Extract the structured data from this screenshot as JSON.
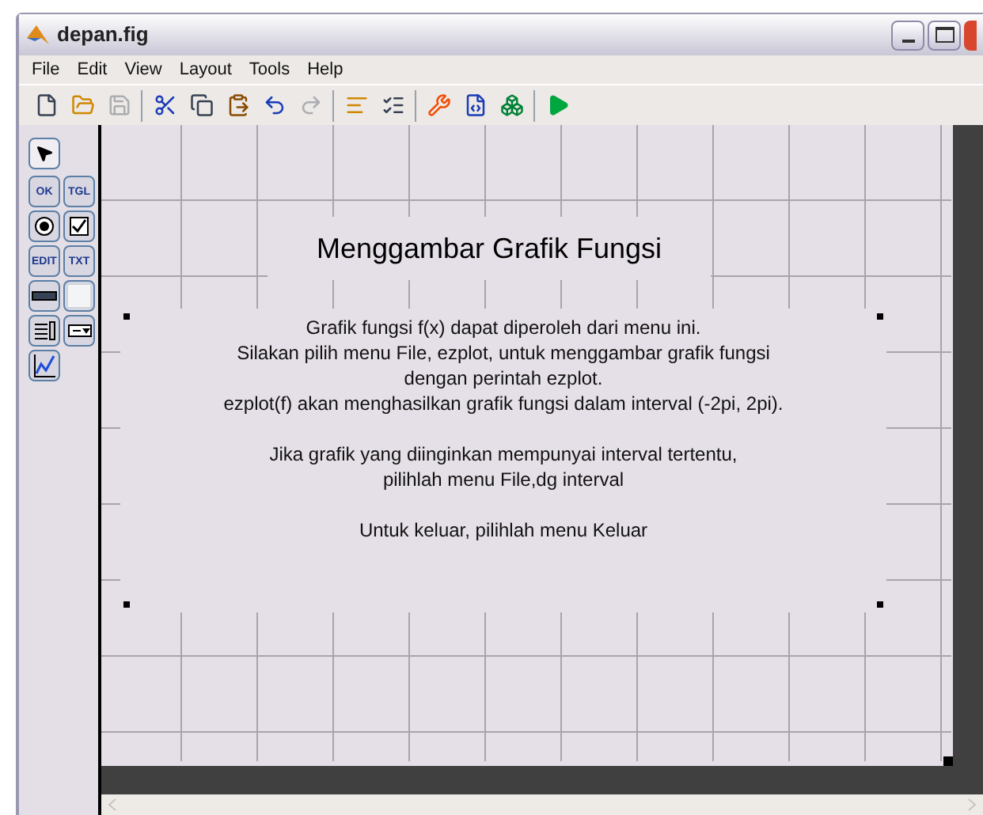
{
  "window": {
    "title": "depan.fig"
  },
  "menu": [
    {
      "label": "File"
    },
    {
      "label": "Edit"
    },
    {
      "label": "View"
    },
    {
      "label": "Layout"
    },
    {
      "label": "Tools"
    },
    {
      "label": "Help"
    }
  ],
  "toolbar": [
    {
      "kind": "new",
      "disabled": false
    },
    {
      "kind": "open",
      "disabled": false
    },
    {
      "kind": "save",
      "disabled": true
    },
    {
      "kind": "sep"
    },
    {
      "kind": "cut",
      "disabled": false
    },
    {
      "kind": "copy",
      "disabled": false
    },
    {
      "kind": "paste",
      "disabled": false
    },
    {
      "kind": "undo",
      "disabled": false
    },
    {
      "kind": "redo",
      "disabled": true
    },
    {
      "kind": "sep"
    },
    {
      "kind": "align",
      "disabled": false
    },
    {
      "kind": "menu-editor",
      "disabled": false
    },
    {
      "kind": "sep"
    },
    {
      "kind": "property",
      "disabled": false
    },
    {
      "kind": "mfile",
      "disabled": false
    },
    {
      "kind": "browser",
      "disabled": false
    },
    {
      "kind": "sep"
    },
    {
      "kind": "run",
      "disabled": false
    }
  ],
  "palette": [
    {
      "kind": "pointer",
      "selected": true
    },
    {
      "kind": "text",
      "label": "OK",
      "selected": false
    },
    {
      "kind": "text",
      "label": "TGL",
      "selected": false
    },
    {
      "kind": "radio",
      "selected": false
    },
    {
      "kind": "checkbox",
      "selected": false
    },
    {
      "kind": "text",
      "label": "EDIT",
      "selected": false
    },
    {
      "kind": "text",
      "label": "TXT",
      "selected": false
    },
    {
      "kind": "slider",
      "selected": false
    },
    {
      "kind": "frame",
      "selected": false
    },
    {
      "kind": "listbox",
      "selected": false
    },
    {
      "kind": "popup",
      "selected": false
    },
    {
      "kind": "axes",
      "selected": false
    }
  ],
  "canvas": {
    "title": "Menggambar Grafik Fungsi",
    "paragraphs": [
      [
        "Grafik fungsi f(x) dapat diperoleh dari menu ini.",
        "Silakan pilih menu File, ezplot, untuk menggambar grafik fungsi",
        "dengan perintah ezplot.",
        "ezplot(f) akan menghasilkan grafik fungsi dalam interval (-2pi, 2pi)."
      ],
      [
        "Jika grafik yang diinginkan mempunyai interval tertentu,",
        "pilihlah menu File,dg interval"
      ],
      [
        "Untuk keluar, pilihlah menu Keluar"
      ]
    ]
  }
}
